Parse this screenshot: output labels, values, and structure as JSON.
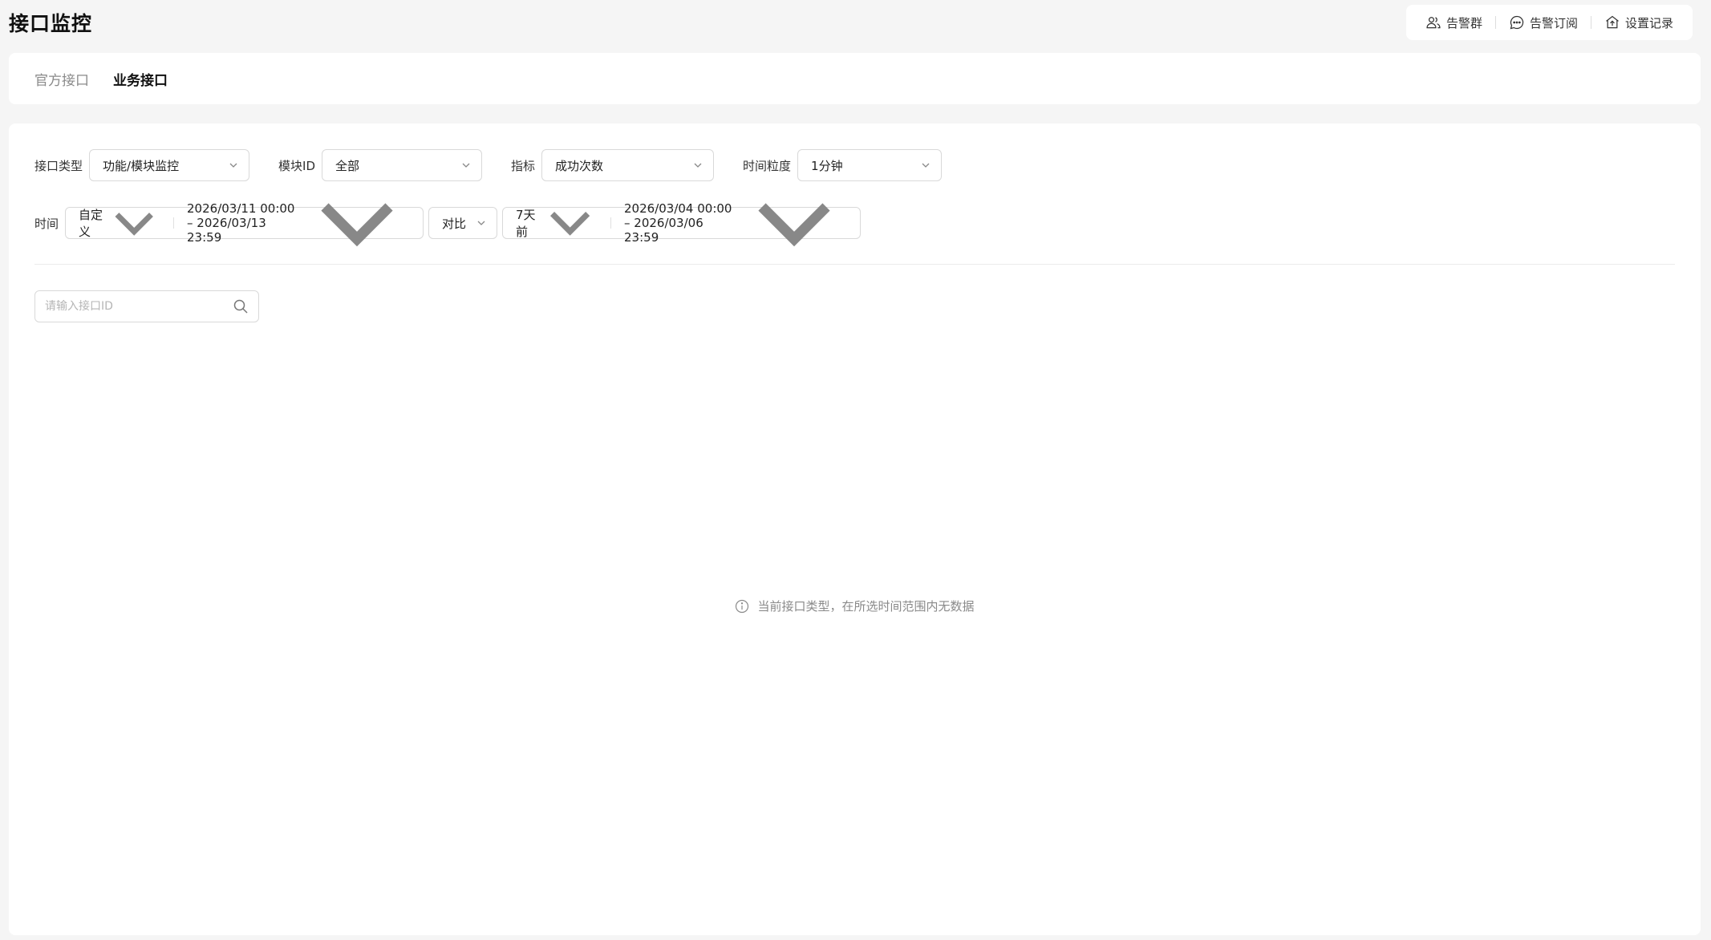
{
  "page": {
    "title": "接口监控"
  },
  "top_actions": [
    {
      "label": "告警群",
      "icon": "group-icon"
    },
    {
      "label": "告警订阅",
      "icon": "chat-icon"
    },
    {
      "label": "设置记录",
      "icon": "upload-record-icon"
    }
  ],
  "tabs": [
    {
      "label": "官方接口",
      "active": false
    },
    {
      "label": "业务接口",
      "active": true
    }
  ],
  "filters": {
    "interface_type": {
      "label": "接口类型",
      "value": "功能/模块监控"
    },
    "module_id": {
      "label": "模块ID",
      "value": "全部"
    },
    "metric": {
      "label": "指标",
      "value": "成功次数"
    },
    "granularity": {
      "label": "时间粒度",
      "value": "1分钟"
    },
    "time": {
      "label": "时间",
      "mode": "自定义",
      "range": "2026/03/11 00:00 – 2026/03/13 23:59"
    },
    "compare": {
      "mode": "对比",
      "offset": "7天前",
      "range": "2026/03/04 00:00 – 2026/03/06 23:59"
    }
  },
  "search": {
    "placeholder": "请输入接口ID",
    "value": ""
  },
  "empty_state": {
    "message": "当前接口类型，在所选时间范围内无数据"
  }
}
